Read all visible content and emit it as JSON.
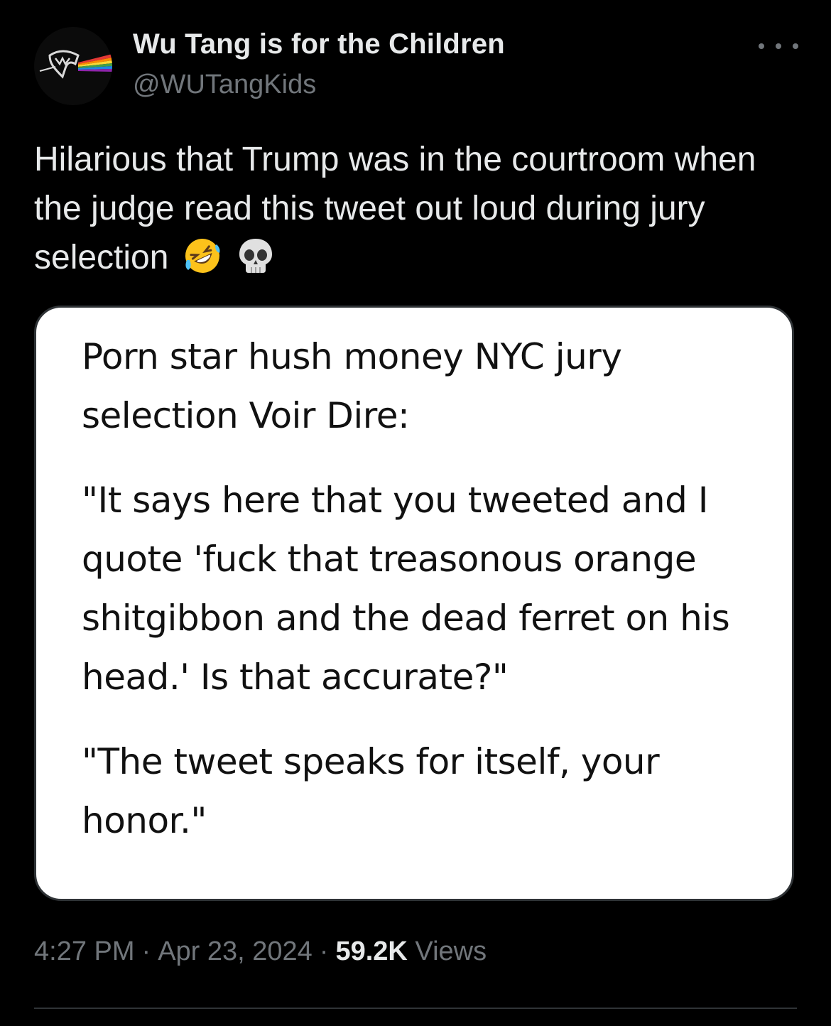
{
  "author": {
    "display_name": "Wu Tang is for the Children",
    "handle": "@WUTangKids",
    "avatar_icon": "wu-tang-prism-logo"
  },
  "tweet": {
    "text": "Hilarious that Trump was in the courtroom when the judge read this tweet out loud during jury selection",
    "emojis": [
      "rolling-on-floor-laughing-emoji",
      "skull-emoji"
    ]
  },
  "media": {
    "heading": "Porn star hush money NYC jury selection Voir Dire:",
    "question": "\"It says here that you tweeted and I quote 'fuck that treasonous orange shitgibbon and the dead ferret on his head.' Is that accurate?\"",
    "answer": "\"The tweet speaks for itself, your honor.\""
  },
  "meta": {
    "time": "4:27 PM",
    "separator": "·",
    "date": "Apr 23, 2024",
    "views_count": "59.2K",
    "views_label": "Views"
  },
  "colors": {
    "background": "#000000",
    "primary_text": "#e7e9ea",
    "secondary_text": "#71767b",
    "border": "#2f3336"
  }
}
